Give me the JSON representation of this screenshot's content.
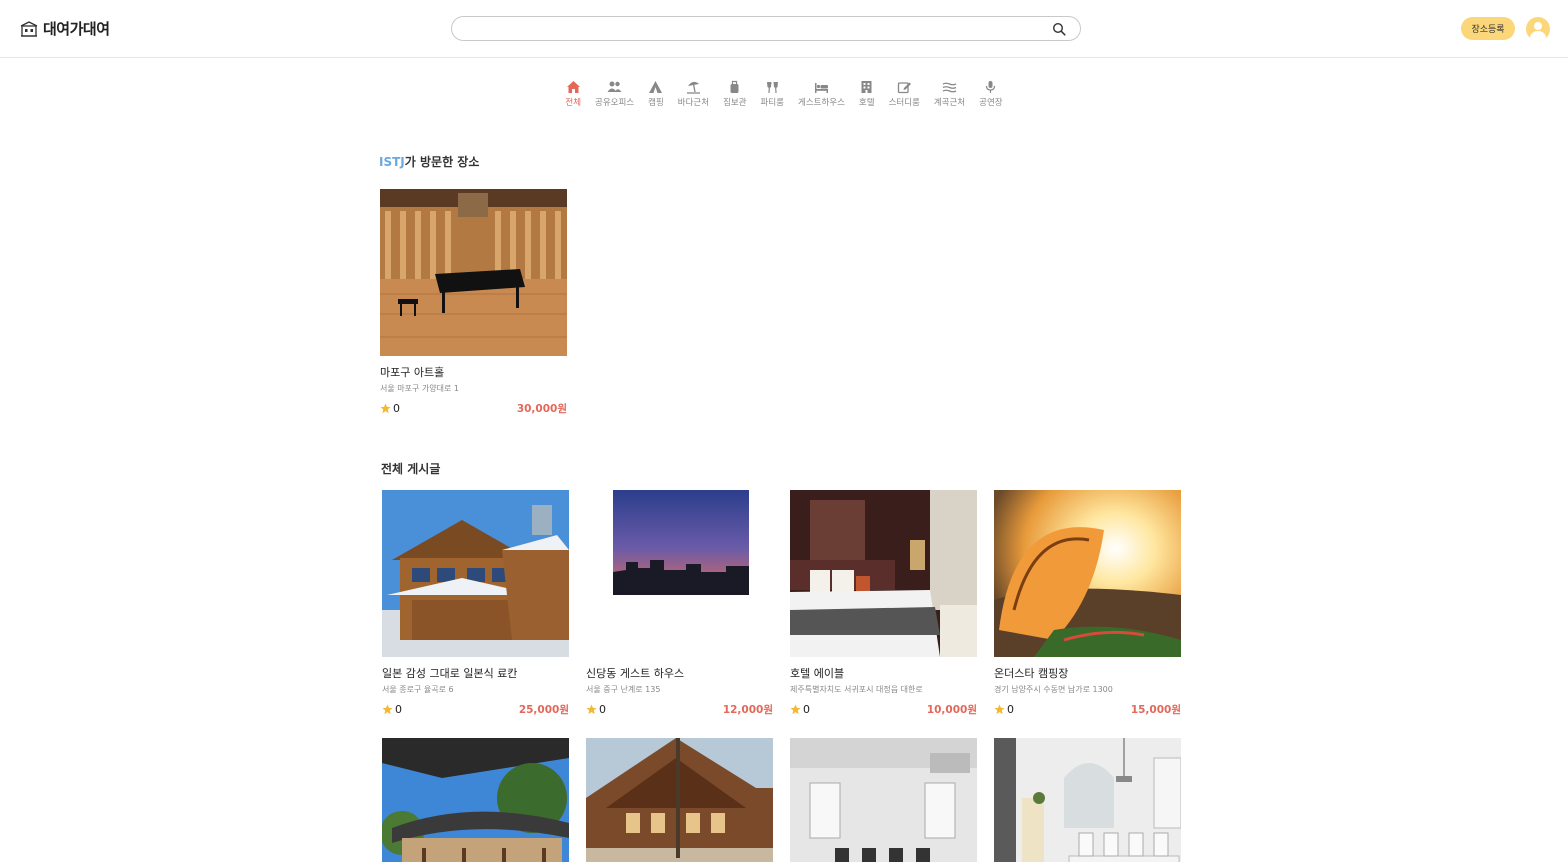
{
  "header": {
    "logo_text": "대여가대여",
    "search": {
      "value": "",
      "placeholder": ""
    },
    "register_label": "장소등록"
  },
  "categories": [
    {
      "label": "전체",
      "icon": "home-icon",
      "active": true
    },
    {
      "label": "공유오피스",
      "icon": "users-icon"
    },
    {
      "label": "캠핑",
      "icon": "tent-icon"
    },
    {
      "label": "바다근처",
      "icon": "beach-umbrella-icon"
    },
    {
      "label": "짐보관",
      "icon": "luggage-icon"
    },
    {
      "label": "파티룸",
      "icon": "glasses-icon"
    },
    {
      "label": "게스트하우스",
      "icon": "bed-icon"
    },
    {
      "label": "호텔",
      "icon": "hotel-icon"
    },
    {
      "label": "스터디룸",
      "icon": "pencil-square-icon"
    },
    {
      "label": "계곡근처",
      "icon": "water-icon"
    },
    {
      "label": "공연장",
      "icon": "microphone-icon"
    }
  ],
  "visited": {
    "title_highlight": "ISTJ",
    "title_rest": "가 방문한 장소",
    "items": [
      {
        "title": "마포구 아트홀",
        "address": "서울 마포구 가양대로 1",
        "rating": "0",
        "price": "30,000원"
      }
    ]
  },
  "all_posts": {
    "title": "전체 게시글",
    "items": [
      {
        "title": "일본 감성 그대로 일본식 료칸",
        "address": "서울 종로구 율곡로 6",
        "rating": "0",
        "price": "25,000원"
      },
      {
        "title": "신당동 게스트 하우스",
        "address": "서울 중구 난계로 135",
        "rating": "0",
        "price": "12,000원"
      },
      {
        "title": "호텔 에이블",
        "address": "제주특별자치도 서귀포시 대정읍 대한로",
        "rating": "0",
        "price": "10,000원"
      },
      {
        "title": "온더스타 캠핑장",
        "address": "경기 남양주시 수동면 납가로 1300",
        "rating": "0",
        "price": "15,000원"
      }
    ]
  },
  "colors": {
    "accent": "#e2685a",
    "brand_yellow": "#fcd77a",
    "highlight_blue": "#6aa9e0",
    "star": "#f5b82e"
  }
}
